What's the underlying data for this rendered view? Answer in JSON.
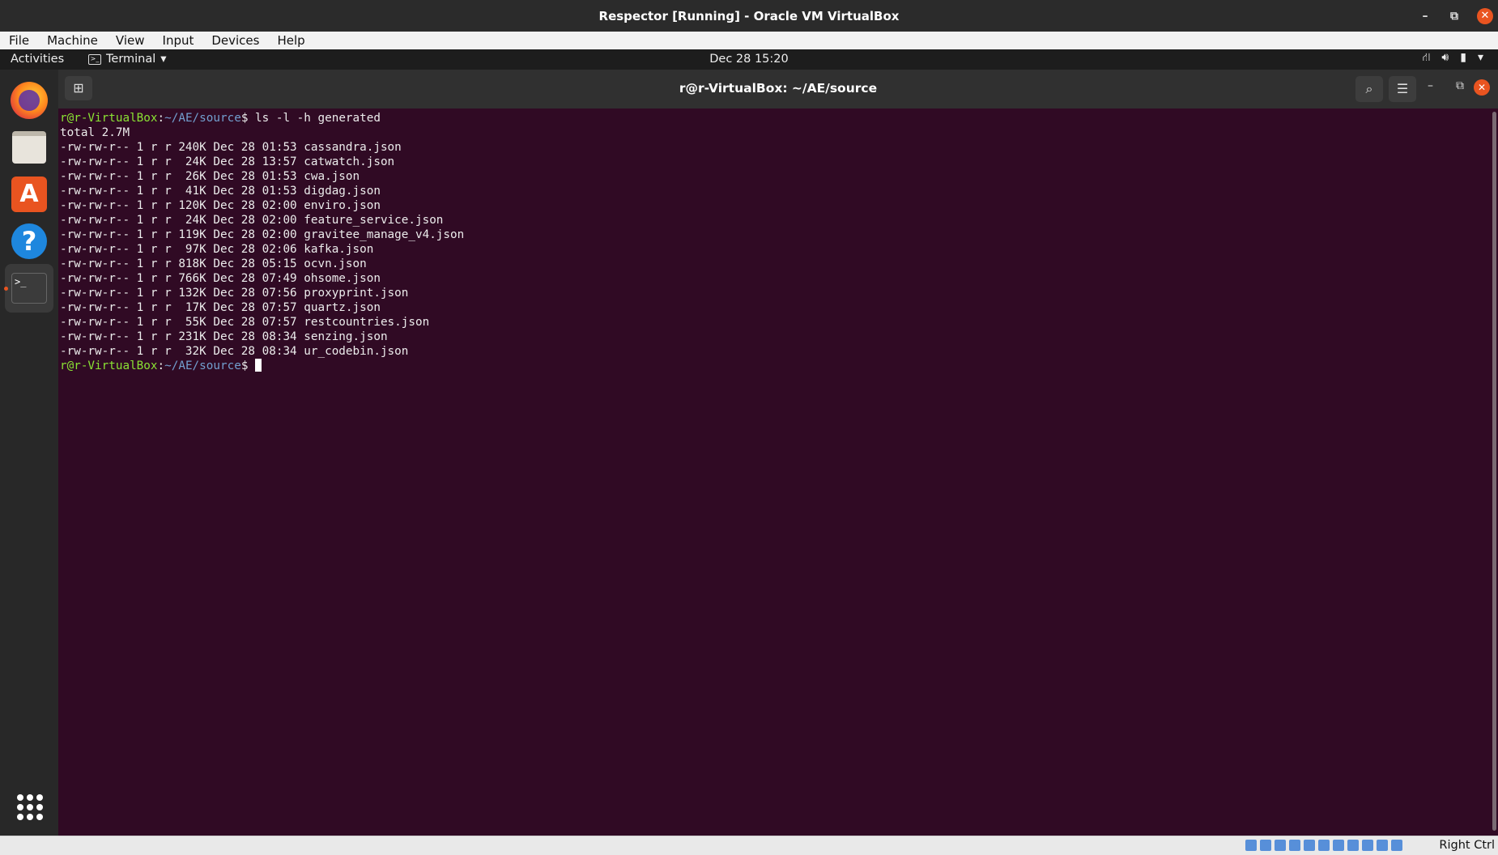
{
  "window": {
    "title": "Respector [Running] - Oracle VM VirtualBox",
    "min": "–",
    "restore": "⧉",
    "close": "✕"
  },
  "menubar": [
    "File",
    "Machine",
    "View",
    "Input",
    "Devices",
    "Help"
  ],
  "topbar": {
    "activities": "Activities",
    "app": "Terminal",
    "clock": "Dec 28  15:20"
  },
  "dock": [
    "Firefox",
    "Files",
    "Ubuntu Software",
    "Help",
    "Terminal",
    "Show Applications"
  ],
  "terminal": {
    "title": "r@r-VirtualBox: ~/AE/source",
    "user_host": "r@r-VirtualBox",
    "path": "~/AE/source",
    "command": "ls -l -h generated",
    "total": "total 2.7M",
    "lines": [
      "-rw-rw-r-- 1 r r 240K Dec 28 01:53 cassandra.json",
      "-rw-rw-r-- 1 r r  24K Dec 28 13:57 catwatch.json",
      "-rw-rw-r-- 1 r r  26K Dec 28 01:53 cwa.json",
      "-rw-rw-r-- 1 r r  41K Dec 28 01:53 digdag.json",
      "-rw-rw-r-- 1 r r 120K Dec 28 02:00 enviro.json",
      "-rw-rw-r-- 1 r r  24K Dec 28 02:00 feature_service.json",
      "-rw-rw-r-- 1 r r 119K Dec 28 02:00 gravitee_manage_v4.json",
      "-rw-rw-r-- 1 r r  97K Dec 28 02:06 kafka.json",
      "-rw-rw-r-- 1 r r 818K Dec 28 05:15 ocvn.json",
      "-rw-rw-r-- 1 r r 766K Dec 28 07:49 ohsome.json",
      "-rw-rw-r-- 1 r r 132K Dec 28 07:56 proxyprint.json",
      "-rw-rw-r-- 1 r r  17K Dec 28 07:57 quartz.json",
      "-rw-rw-r-- 1 r r  55K Dec 28 07:57 restcountries.json",
      "-rw-rw-r-- 1 r r 231K Dec 28 08:34 senzing.json",
      "-rw-rw-r-- 1 r r  32K Dec 28 08:34 ur_codebin.json"
    ]
  },
  "statusbar": {
    "host_key": "Right Ctrl"
  }
}
